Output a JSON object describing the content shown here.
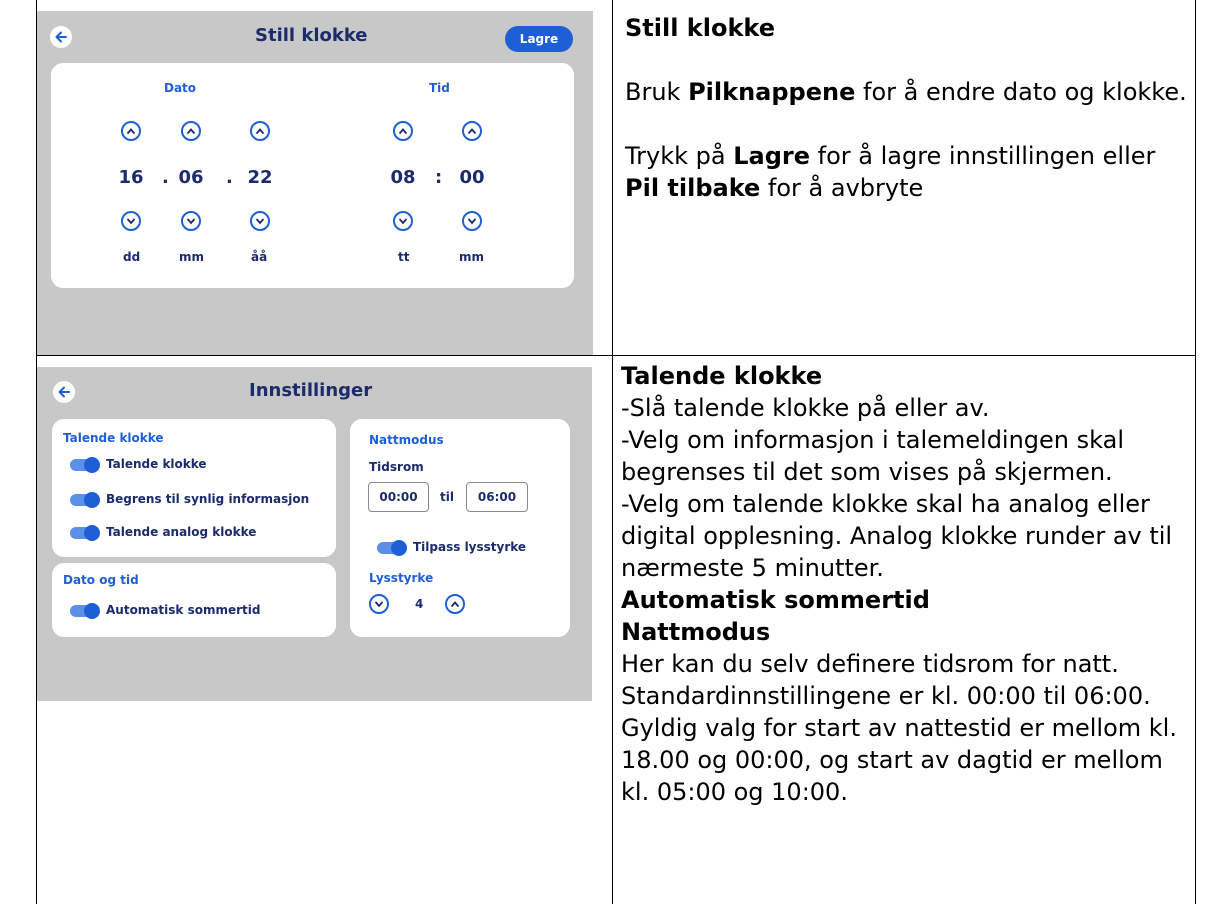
{
  "clock_screen": {
    "title": "Still klokke",
    "save_label": "Lagre",
    "date_heading": "Dato",
    "time_heading": "Tid",
    "day": "16",
    "month": "06",
    "year": "22",
    "hour": "08",
    "minute": "00",
    "date_separator": ".",
    "time_separator": ":",
    "unit_day": "dd",
    "unit_month": "mm",
    "unit_year": "åå",
    "unit_hour": "tt",
    "unit_minute": "mm"
  },
  "settings_screen": {
    "title": "Innstillinger",
    "talking_section": "Talende klokke",
    "toggle_talking": "Talende klokke",
    "toggle_limit": "Begrens til synlig informasjon",
    "toggle_analog": "Talende analog klokke",
    "datetime_section": "Dato og tid",
    "toggle_dst": "Automatisk sommertid",
    "night_section": "Nattmodus",
    "period_label": "Tidsrom",
    "night_start": "00:00",
    "night_to": "til",
    "night_end": "06:00",
    "toggle_brightness": "Tilpass lysstyrke",
    "brightness_label": "Lysstyrke",
    "brightness_value": "4"
  },
  "row1_text": {
    "heading": "Still klokke",
    "p1_pre": "Bruk ",
    "p1_bold": "Pilknappene",
    "p1_post": " for å endre dato og klokke.",
    "p2_pre": "Trykk på ",
    "p2_bold1": "Lagre",
    "p2_mid": " for å lagre innstillingen eller ",
    "p2_bold2": "Pil tilbake",
    "p2_post": " for å avbryte"
  },
  "row2_text": {
    "heading1": "Talende klokke",
    "line1": "-Slå talende klokke på eller av.",
    "line2": "-Velg om informasjon i talemeldingen skal begrenses til det som vises på skjermen.",
    "line3": "-Velg om talende klokke skal ha analog eller digital opplesning. Analog klokke runder av til nærmeste 5 minutter.",
    "heading2": "Automatisk sommertid",
    "heading3": "Nattmodus",
    "line4": "Her kan du selv definere tidsrom for natt. Standardinnstillingene er kl. 00:00 til 06:00. Gyldig valg for start av nattestid er mellom kl. 18.00 og 00:00, og start av dagtid er mellom kl. 05:00 og 10:00."
  },
  "colors": {
    "accent_blue": "#1f5fd6",
    "navy_text": "#1b2b6b",
    "panel_grey": "#c8c8c8"
  }
}
